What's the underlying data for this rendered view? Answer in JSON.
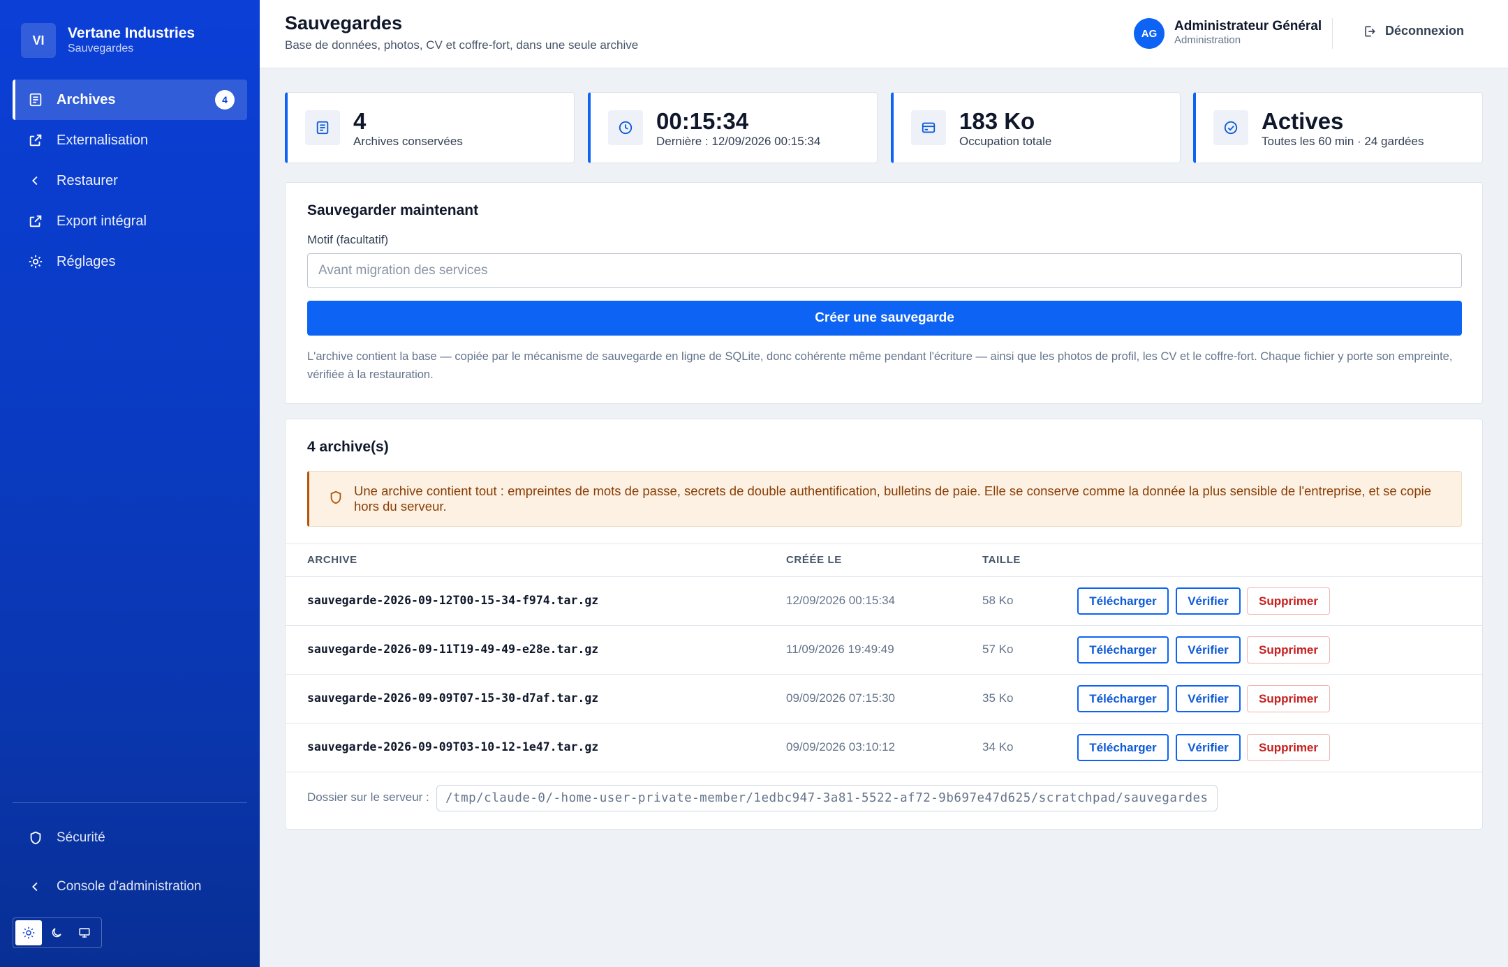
{
  "brand": {
    "initials": "VI",
    "name": "Vertane Industries",
    "subtitle": "Sauvegardes"
  },
  "sidebar": {
    "items": [
      {
        "label": "Archives",
        "icon": "document-icon",
        "active": true,
        "badge": "4"
      },
      {
        "label": "Externalisation",
        "icon": "external-link-icon"
      },
      {
        "label": "Restaurer",
        "icon": "chevron-left-icon"
      },
      {
        "label": "Export intégral",
        "icon": "external-link-icon"
      },
      {
        "label": "Réglages",
        "icon": "gear-icon"
      }
    ],
    "bottom": [
      {
        "label": "Sécurité",
        "icon": "shield-icon"
      },
      {
        "label": "Console d'administration",
        "icon": "chevron-left-icon"
      }
    ],
    "theme_modes": [
      "light",
      "dark",
      "system"
    ]
  },
  "header": {
    "title": "Sauvegardes",
    "subtitle": "Base de données, photos, CV et coffre-fort, dans une seule archive",
    "user": {
      "initials": "AG",
      "name": "Administrateur Général",
      "role": "Administration"
    },
    "logout_label": "Déconnexion"
  },
  "stats": [
    {
      "value": "4",
      "label": "Archives conservées",
      "icon": "document-icon"
    },
    {
      "value": "00:15:34",
      "label": "Dernière : 12/09/2026 00:15:34",
      "icon": "clock-icon"
    },
    {
      "value": "183 Ko",
      "label": "Occupation totale",
      "icon": "storage-icon"
    },
    {
      "value": "Actives",
      "label": "Toutes les 60 min · 24 gardées",
      "icon": "check-circle-icon"
    }
  ],
  "create": {
    "title": "Sauvegarder maintenant",
    "field_label": "Motif (facultatif)",
    "placeholder": "Avant migration des services",
    "value": "",
    "button_label": "Créer une sauvegarde",
    "note": "L'archive contient la base — copiée par le mécanisme de sauvegarde en ligne de SQLite, donc cohérente même pendant l'écriture — ainsi que les photos de profil, les CV et le coffre-fort. Chaque fichier y porte son empreinte, vérifiée à la restauration."
  },
  "archives": {
    "title": "4 archive(s)",
    "alert": "Une archive contient tout : empreintes de mots de passe, secrets de double authentification, bulletins de paie. Elle se conserve comme la donnée la plus sensible de l'entreprise, et se copie hors du serveur.",
    "columns": [
      "ARCHIVE",
      "CRÉÉE LE",
      "TAILLE"
    ],
    "rows": [
      {
        "name": "sauvegarde-2026-09-12T00-15-34-f974.tar.gz",
        "date": "12/09/2026 00:15:34",
        "size": "58 Ko"
      },
      {
        "name": "sauvegarde-2026-09-11T19-49-49-e28e.tar.gz",
        "date": "11/09/2026 19:49:49",
        "size": "57 Ko"
      },
      {
        "name": "sauvegarde-2026-09-09T07-15-30-d7af.tar.gz",
        "date": "09/09/2026 07:15:30",
        "size": "35 Ko"
      },
      {
        "name": "sauvegarde-2026-09-09T03-10-12-1e47.tar.gz",
        "date": "09/09/2026 03:10:12",
        "size": "34 Ko"
      }
    ],
    "actions": {
      "download": "Télécharger",
      "verify": "Vérifier",
      "delete": "Supprimer"
    },
    "folder_label": "Dossier sur le serveur :",
    "folder_path": "/tmp/claude-0/-home-user-private-member/1edbc947-3a81-5522-af72-9b697e47d625/scratchpad/sauvegardes"
  },
  "colors": {
    "primary": "#0d63f3",
    "sidebar": "#0b3fd6",
    "danger": "#c81e1e",
    "warning_bg": "#fcf1e2",
    "warning_text": "#8a3d05"
  }
}
